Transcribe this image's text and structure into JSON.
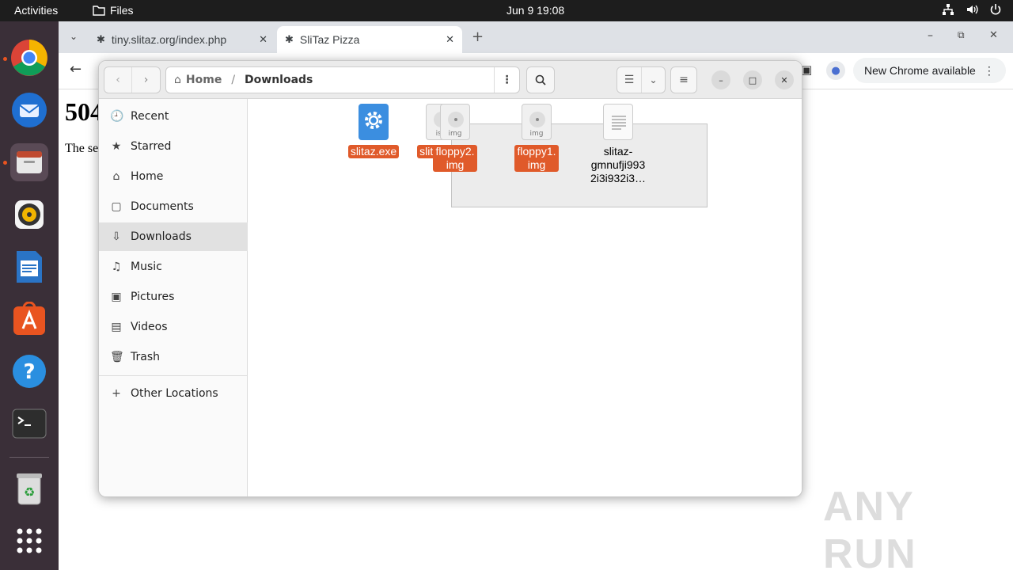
{
  "topbar": {
    "activities": "Activities",
    "app": "Files",
    "clock": "Jun 9  19:08"
  },
  "browser": {
    "tabs": [
      {
        "title": "tiny.slitaz.org/index.php"
      },
      {
        "title": "SliTaz Pizza"
      }
    ],
    "new_chrome": "New Chrome available",
    "page_heading": "504",
    "page_text": "The se"
  },
  "files": {
    "breadcrumb_home": "Home",
    "breadcrumb_sep": "/",
    "breadcrumb_current": "Downloads",
    "sidebar": [
      {
        "label": "Recent",
        "icon": "clock-icon",
        "glyph": "🕘"
      },
      {
        "label": "Starred",
        "icon": "star-icon",
        "glyph": "★"
      },
      {
        "label": "Home",
        "icon": "home-icon",
        "glyph": "⌂"
      },
      {
        "label": "Documents",
        "icon": "document-icon",
        "glyph": "▢"
      },
      {
        "label": "Downloads",
        "icon": "download-icon",
        "glyph": "⇩",
        "selected": true
      },
      {
        "label": "Music",
        "icon": "music-icon",
        "glyph": "♫"
      },
      {
        "label": "Pictures",
        "icon": "pictures-icon",
        "glyph": "▣"
      },
      {
        "label": "Videos",
        "icon": "video-icon",
        "glyph": "▤"
      },
      {
        "label": "Trash",
        "icon": "trash-icon",
        "glyph": "🗑"
      }
    ],
    "other_locations": "Other Locations",
    "items": [
      {
        "name": "slitaz.iso",
        "line1": "slitaz.iso",
        "line2": "",
        "line3": "",
        "type": "iso",
        "selected": true
      },
      {
        "name": "slitaz.exe",
        "line1": "slitaz.exe",
        "line2": "",
        "line3": "",
        "type": "exe",
        "selected": true
      },
      {
        "name": "floppy2.img",
        "line1": "floppy2.",
        "line2": "img",
        "line3": "",
        "type": "img",
        "selected": true
      },
      {
        "name": "floppy1.img",
        "line1": "floppy1.",
        "line2": "img",
        "line3": "",
        "type": "img",
        "selected": true
      },
      {
        "name": "slitaz-gmnufji9932i3i932i3…",
        "line1": "slitaz-",
        "line2": "gmnufji993",
        "line3": "2i3i932i3…",
        "type": "text",
        "selected": false
      }
    ],
    "type_labels": {
      "iso": "iso",
      "img": "img"
    }
  },
  "watermark": "ANY RUN",
  "colors": {
    "selection": "#e05a2a",
    "topbar": "#1d1d1d",
    "dock": "#3a2f38"
  }
}
